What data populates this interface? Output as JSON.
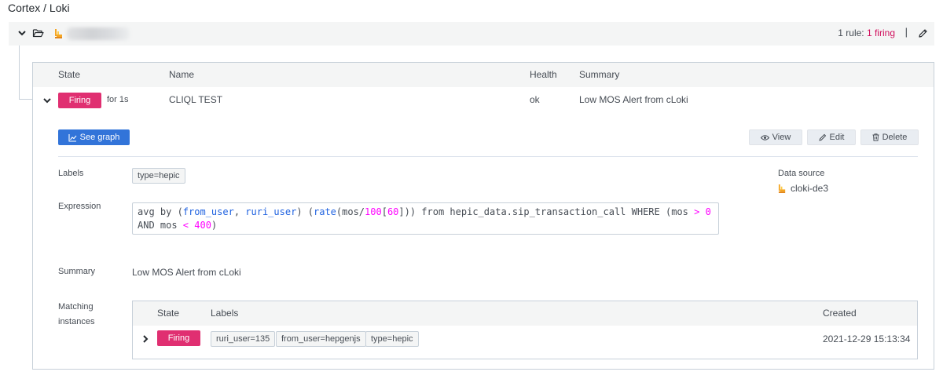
{
  "breadcrumb": "Cortex / Loki",
  "group": {
    "rule_count_prefix": "1 rule: ",
    "rule_count_firing": "1 firing",
    "separator": "|"
  },
  "rules_table": {
    "headers": {
      "state": "State",
      "name": "Name",
      "health": "Health",
      "summary": "Summary"
    },
    "row": {
      "state": "Firing",
      "duration": "for 1s",
      "name": "CLIQL TEST",
      "health": "ok",
      "summary": "Low MOS Alert from cLoki"
    }
  },
  "actions": {
    "see_graph": "See graph",
    "view": "View",
    "edit": "Edit",
    "delete": "Delete"
  },
  "details": {
    "labels_label": "Labels",
    "labels": [
      "type=hepic"
    ],
    "expression_label": "Expression",
    "expression": "avg by (from_user, ruri_user) (rate(mos/100[60])) from hepic_data.sip_transaction_call WHERE (mos > 0 AND mos < 400)",
    "summary_label": "Summary",
    "summary": "Low MOS Alert from cLoki",
    "matching_label_1": "Matching",
    "matching_label_2": "instances",
    "data_source_label": "Data source",
    "data_source": "cloki-de3"
  },
  "instances": {
    "headers": {
      "state": "State",
      "labels": "Labels",
      "created": "Created"
    },
    "rows": [
      {
        "state": "Firing",
        "labels": [
          "ruri_user=135",
          "from_user=hepgenjs",
          "type=hepic"
        ],
        "created": "2021-12-29 15:13:34"
      }
    ]
  },
  "colors": {
    "firing": "#e02f71",
    "firing_text": "#d10e5c",
    "primary": "#3274d9",
    "border": "#c7d0d9",
    "header_bg": "#f4f5f5"
  },
  "icons": {
    "group_toggle": "chevron-down-icon",
    "folder": "folder-open-icon",
    "datasource_logo": "loki-logo-icon",
    "edit_group": "pencil-icon",
    "row_toggle": "chevron-down-icon",
    "graph": "line-chart-icon",
    "view": "eye-icon",
    "edit": "pencil-icon",
    "delete": "trash-icon",
    "instance_toggle": "chevron-right-icon"
  }
}
